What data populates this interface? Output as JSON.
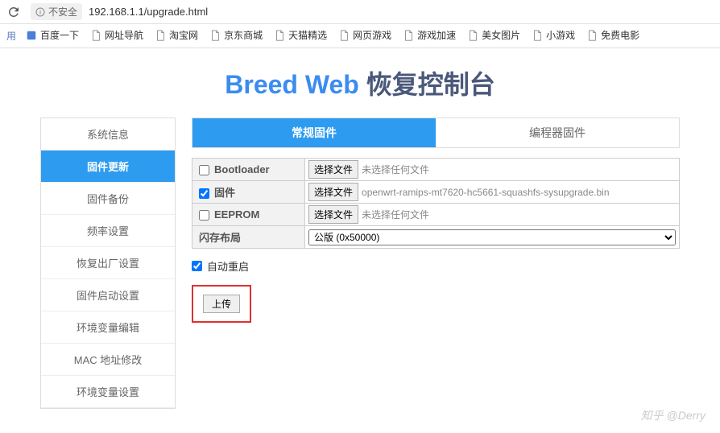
{
  "browser": {
    "security_label": "不安全",
    "url": "192.168.1.1/upgrade.html"
  },
  "bookmarks": {
    "label": "用",
    "items": [
      "百度一下",
      "网址导航",
      "淘宝网",
      "京东商城",
      "天猫精选",
      "网页游戏",
      "游戏加速",
      "美女图片",
      "小游戏",
      "免费电影"
    ]
  },
  "title": {
    "part1": "Breed Web",
    "part2": " 恢复控制台"
  },
  "sidebar": {
    "items": [
      "系统信息",
      "固件更新",
      "固件备份",
      "频率设置",
      "恢复出厂设置",
      "固件启动设置",
      "环境变量编辑",
      "MAC 地址修改",
      "环境变量设置"
    ],
    "active_index": 1
  },
  "tabs": {
    "items": [
      "常规固件",
      "编程器固件"
    ],
    "active_index": 0
  },
  "form": {
    "rows": [
      {
        "label": "Bootloader",
        "checked": false,
        "file_btn": "选择文件",
        "file_text": "未选择任何文件"
      },
      {
        "label": "固件",
        "checked": true,
        "file_btn": "选择文件",
        "file_text": "openwrt-ramips-mt7620-hc5661-squashfs-sysupgrade.bin"
      },
      {
        "label": "EEPROM",
        "checked": false,
        "file_btn": "选择文件",
        "file_text": "未选择任何文件"
      }
    ],
    "flash_layout_label": "闪存布局",
    "flash_layout_value": "公版 (0x50000)"
  },
  "auto_reboot": {
    "label": "自动重启",
    "checked": true
  },
  "upload_btn": "上传",
  "watermark": "知乎 @Derry"
}
